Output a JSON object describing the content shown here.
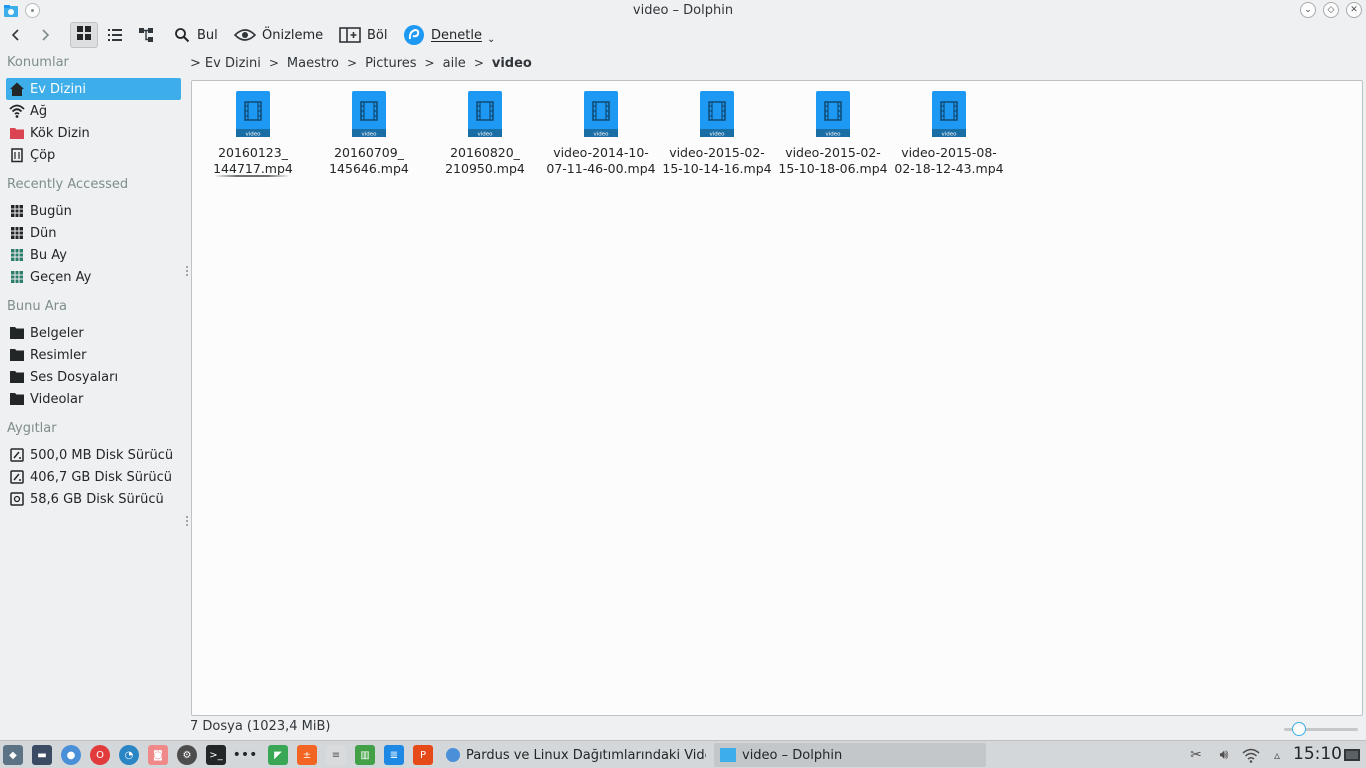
{
  "window": {
    "title": "video – Dolphin",
    "controls": [
      "minimize",
      "maximize",
      "close"
    ]
  },
  "toolbar": {
    "back": "back",
    "forward": "forward",
    "views": [
      "icons-view",
      "details-view",
      "split-view"
    ],
    "find_label": "Bul",
    "preview_label": "Önizleme",
    "split_label": "Böl",
    "control_label": "Denetle"
  },
  "breadcrumb": {
    "items": [
      "Ev Dizini",
      "Maestro",
      "Pictures",
      "aile",
      "video"
    ]
  },
  "sidebar": {
    "places_heading": "Konumlar",
    "places": [
      {
        "label": "Ev Dizini",
        "icon": "home-icon",
        "selected": true
      },
      {
        "label": "Ağ",
        "icon": "network-icon"
      },
      {
        "label": "Kök Dizin",
        "icon": "root-folder-icon"
      },
      {
        "label": "Çöp",
        "icon": "trash-icon"
      }
    ],
    "recent_heading": "Recently Accessed",
    "recent": [
      {
        "label": "Bugün",
        "icon": "calendar-icon"
      },
      {
        "label": "Dün",
        "icon": "calendar-icon"
      },
      {
        "label": "Bu Ay",
        "icon": "calendar-icon"
      },
      {
        "label": "Geçen Ay",
        "icon": "calendar-icon"
      }
    ],
    "search_heading": "Bunu Ara",
    "search": [
      {
        "label": "Belgeler",
        "icon": "folder-icon"
      },
      {
        "label": "Resimler",
        "icon": "folder-icon"
      },
      {
        "label": "Ses Dosyaları",
        "icon": "folder-icon"
      },
      {
        "label": "Videolar",
        "icon": "folder-icon"
      }
    ],
    "devices_heading": "Aygıtlar",
    "devices": [
      {
        "label": "500,0 MB Disk Sürücü",
        "icon": "drive-icon"
      },
      {
        "label": "406,7 GB Disk Sürücü",
        "icon": "drive-icon"
      },
      {
        "label": "58,6 GB Disk Sürücü",
        "icon": "drive-icon"
      }
    ]
  },
  "files": [
    {
      "line1": "20160123_",
      "line2": "144717.mp4"
    },
    {
      "line1": "20160709_",
      "line2": "145646.mp4"
    },
    {
      "line1": "20160820_",
      "line2": "210950.mp4"
    },
    {
      "line1": "video-2014-10-",
      "line2": "07-11-46-00.mp4"
    },
    {
      "line1": "video-2015-02-",
      "line2": "15-10-14-16.mp4"
    },
    {
      "line1": "video-2015-02-",
      "line2": "15-10-18-06.mp4"
    },
    {
      "line1": "video-2015-08-",
      "line2": "02-18-12-43.mp4"
    }
  ],
  "file_icon_tag": "video",
  "status": {
    "text": "7 Dosya (1023,4 MiB)",
    "zoom_fraction": 0.2
  },
  "taskbar": {
    "launchers": [
      "menu-icon",
      "desktop-icon",
      "chromium-icon",
      "opera-icon",
      "browser-icon",
      "screenshot-icon",
      "settings-icon",
      "terminal-icon",
      "more-icon",
      "maps-icon",
      "calc-icon",
      "notes-icon",
      "spreadsheet-icon",
      "writer-icon",
      "presentation-icon"
    ],
    "tasks": [
      {
        "label": "Pardus ve Linux Dağıtımlarındaki Vide",
        "icon": "chromium-icon",
        "active": false
      },
      {
        "label": "video – Dolphin",
        "icon": "dolphin-icon",
        "active": true
      }
    ],
    "clock": "15:10"
  },
  "colors": {
    "accent": "#3daee9",
    "window_bg": "#eff0f1",
    "view_bg": "#fcfcfc",
    "text": "#232627"
  }
}
